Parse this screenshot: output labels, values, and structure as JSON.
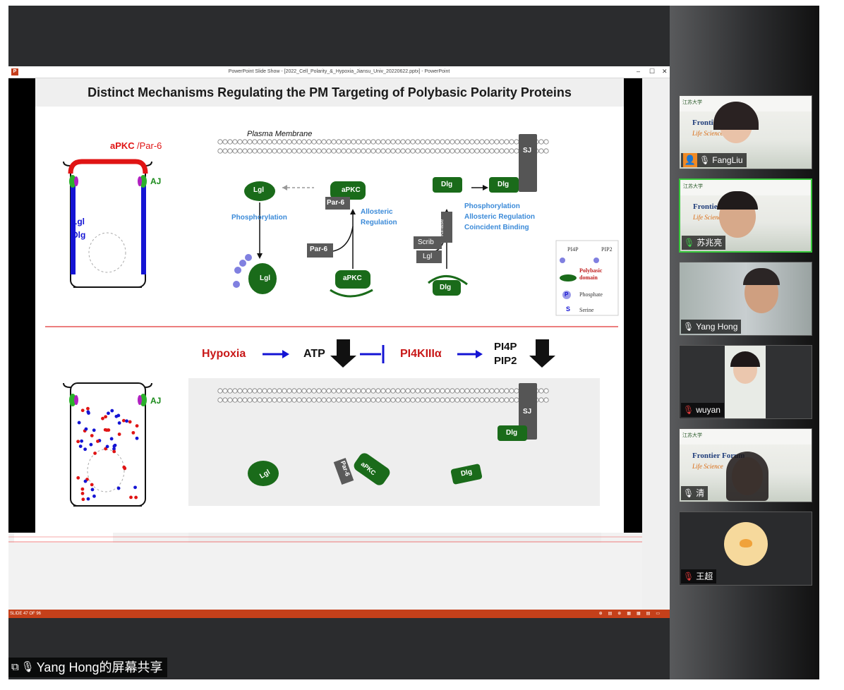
{
  "ppt": {
    "window_title": "PowerPoint Slide Show - [2022_Cell_Polarity_&_Hypoxia_Jiansu_Univ_20220622.pptx] - PowerPoint",
    "logo_letter": "P",
    "minimize": "–",
    "restore": "☐",
    "close": "✕",
    "slide_counter": "SLIDE 47 OF 96",
    "status_icons": "⊕▤⊕▦▦▤▭"
  },
  "slide": {
    "title": "Distinct Mechanisms Regulating the PM Targeting of Polybasic Polarity Proteins",
    "labels": {
      "apkc": "aPKC",
      "par6_slash": "/Par-6",
      "aj": "AJ",
      "lgl": "Lgl",
      "dlg": "Dlg",
      "plasma_membrane": "Plasma Membrane",
      "sj": "SJ",
      "phosphorylation": "Phosphorylation",
      "allosteric_regulation_1": "Allosteric",
      "allosteric_regulation_2": "Regulation",
      "par6": "Par-6",
      "kinase": "Kinase",
      "scrib": "Scrib",
      "multi_1": "Phosphorylation",
      "multi_2": "Allosteric Regulation",
      "multi_3": "Coincident Binding",
      "hypoxia": "Hypoxia",
      "atp": "ATP",
      "pi4k": "PI4KIIIα",
      "pi4p": "PI4P",
      "pip2": "PIP2"
    },
    "legend": {
      "pi4p": "PI4P",
      "pip2": "PIP2",
      "polybasic": "Polybasic domain",
      "phosphate": "Phosphate",
      "phosphate_symbol": "P",
      "serine": "Serine",
      "serine_symbol": "S"
    }
  },
  "share": {
    "label": "Yang Hong的屏幕共享"
  },
  "participants": [
    {
      "name": "FangLiu",
      "mic": "on"
    },
    {
      "name": "苏兆亮",
      "mic": "talking"
    },
    {
      "name": "Yang Hong",
      "mic": "on"
    },
    {
      "name": "wuyan",
      "mic": "muted"
    },
    {
      "name": "清",
      "mic": "on"
    },
    {
      "name": "王超",
      "mic": "muted"
    }
  ],
  "banner": {
    "frontier": "Frontier",
    "frontier_forum": "Frontier Forum",
    "life_science": "Life Science",
    "school": "江苏大学"
  },
  "colors": {
    "green": "#1a6b1a",
    "red": "#e01414",
    "blue": "#1414d4",
    "accent_orange": "#c5401a"
  }
}
